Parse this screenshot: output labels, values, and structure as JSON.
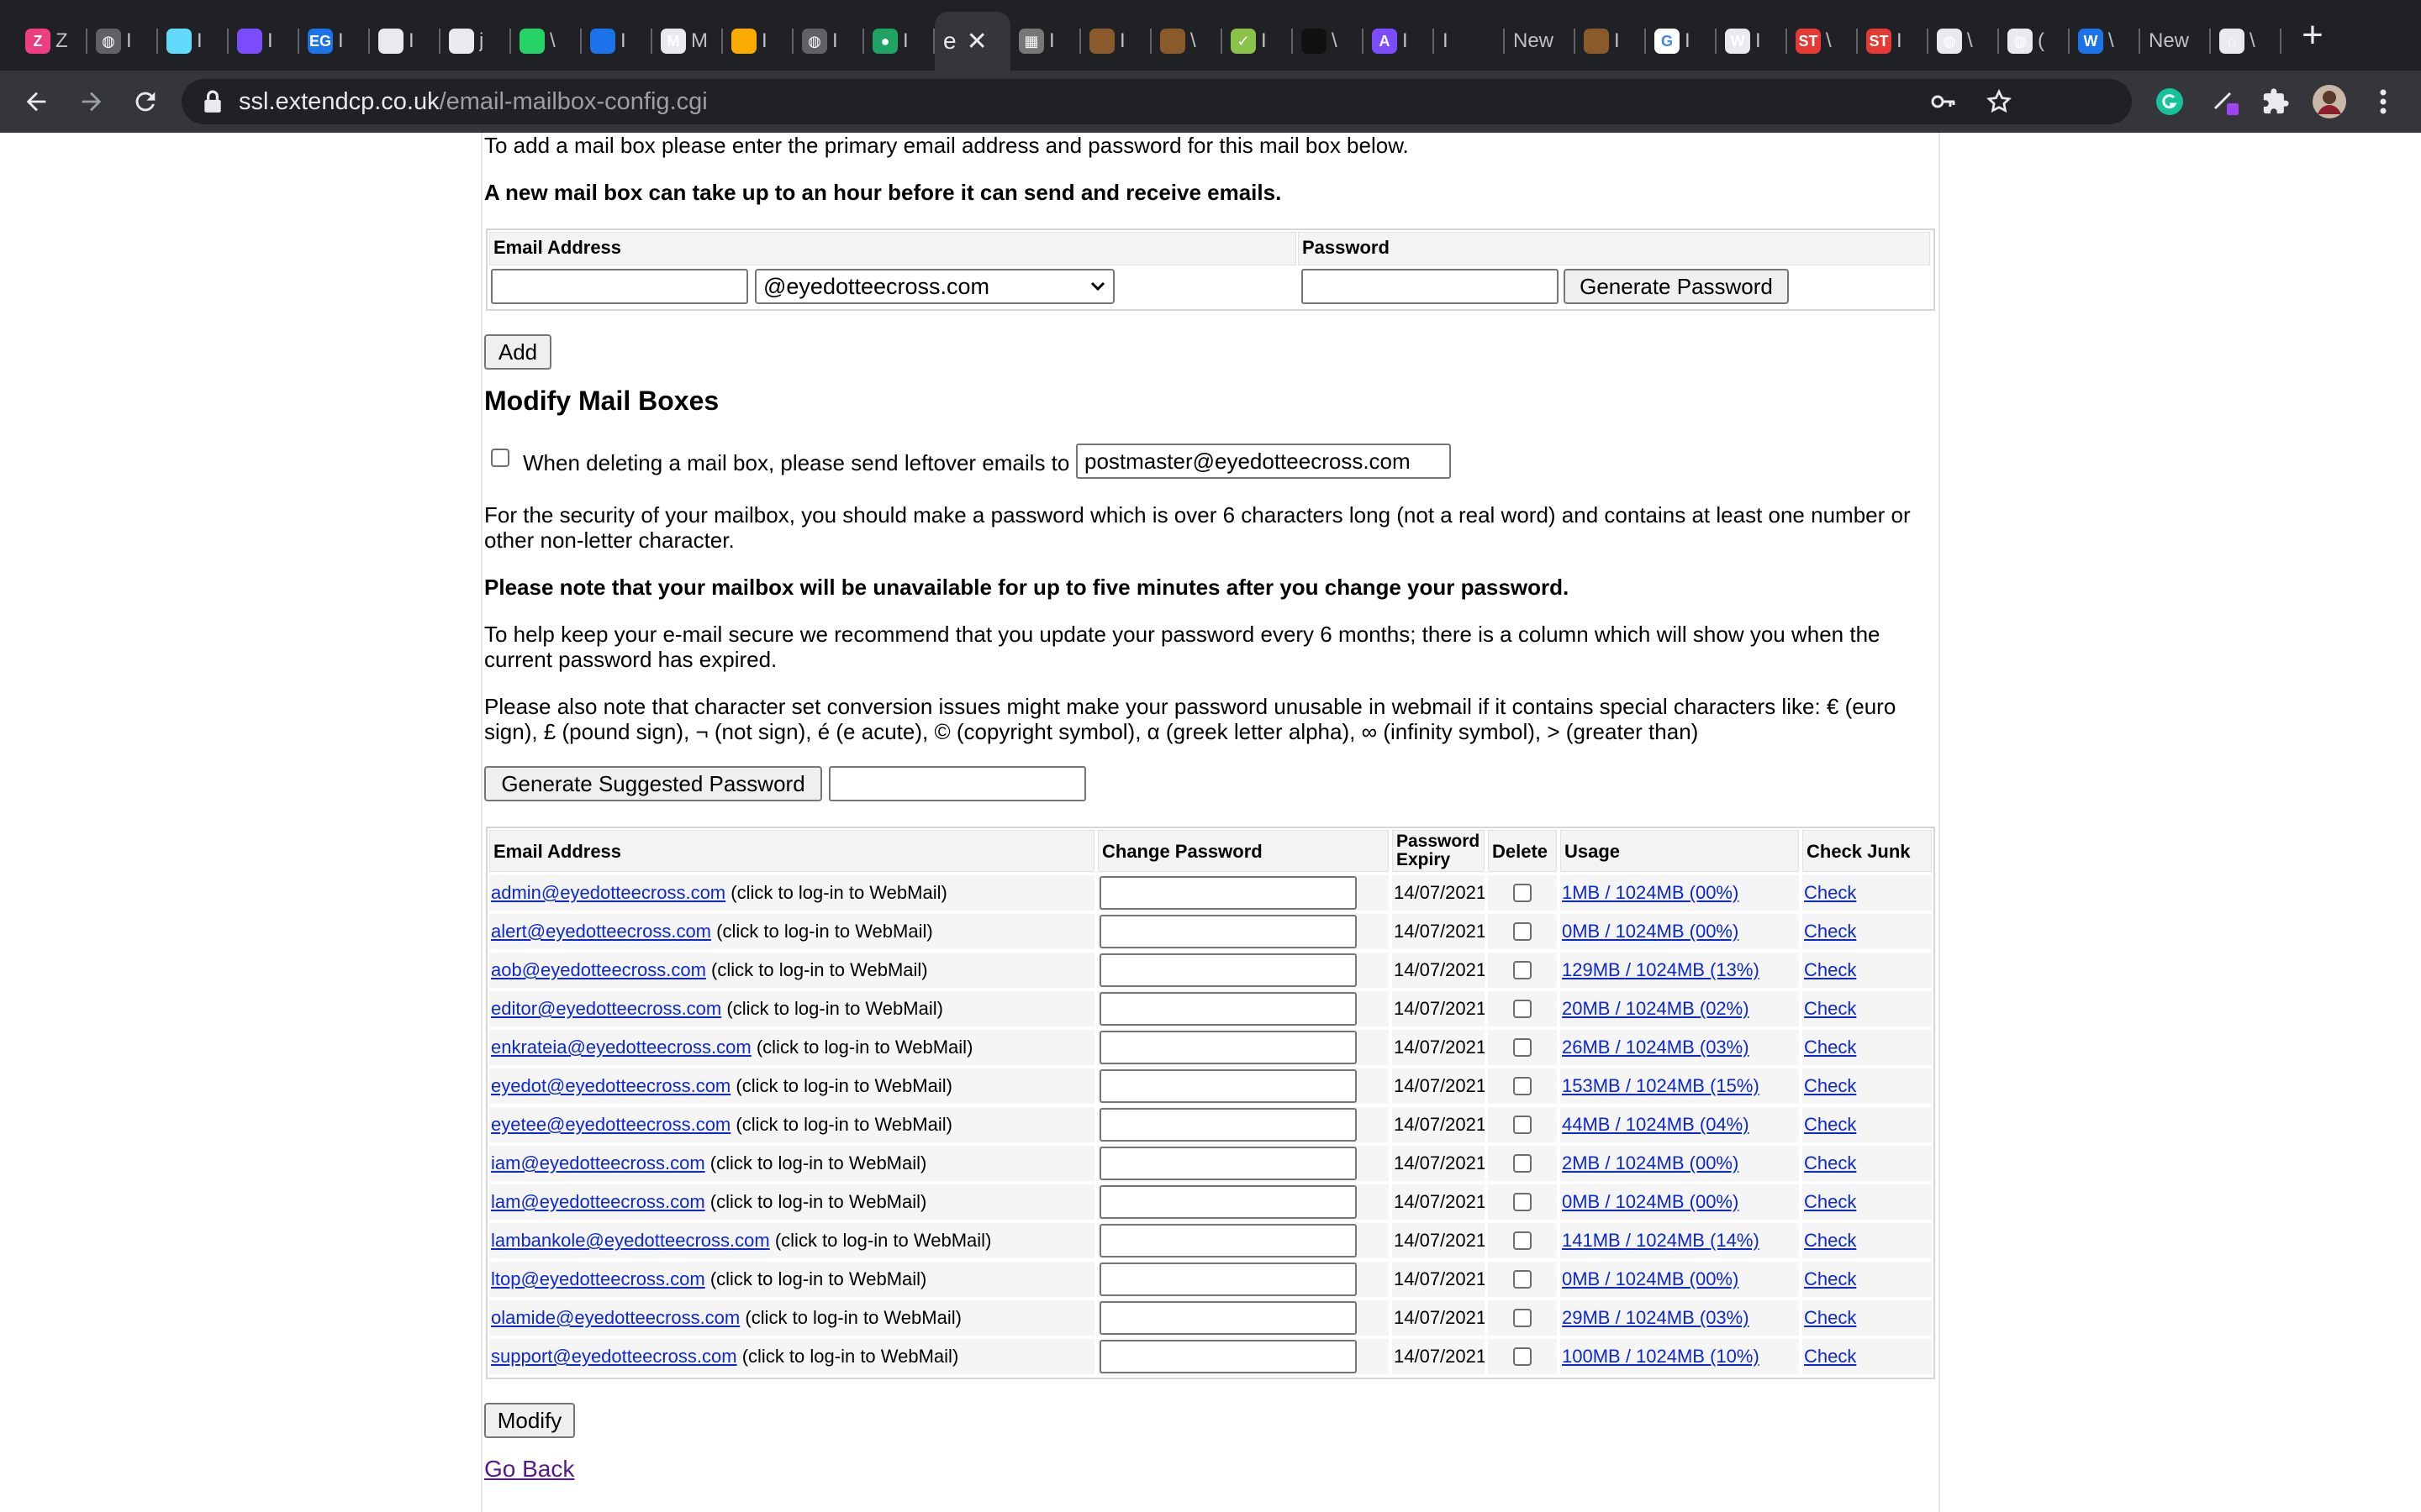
{
  "browser": {
    "tabs": [
      {
        "icon": "zeplin-icon",
        "title": "Z",
        "color": "#ee3e82"
      },
      {
        "icon": "globe-gray-icon",
        "title": "I",
        "color": "#5f6368"
      },
      {
        "icon": "react-icon",
        "title": "I",
        "color": "#61dafb"
      },
      {
        "icon": "circle-purple-icon",
        "title": "I",
        "color": "#7c4dff"
      },
      {
        "icon": "eg-icon",
        "title": "I",
        "color": "#1a73e8"
      },
      {
        "icon": "github-icon",
        "title": "I",
        "color": "#e8eaed"
      },
      {
        "icon": "github-icon",
        "title": "j",
        "color": "#e8eaed"
      },
      {
        "icon": "whatsapp-icon",
        "title": "\\",
        "color": "#25d366"
      },
      {
        "icon": "box-blue-icon",
        "title": "I",
        "color": "#1a73e8"
      },
      {
        "icon": "medium-icon",
        "title": "M",
        "color": "#e8eaed"
      },
      {
        "icon": "bars-chart-icon",
        "title": "I",
        "color": "#f9ab00"
      },
      {
        "icon": "globe-gray-icon",
        "title": "I",
        "color": "#5f6368"
      },
      {
        "icon": "green-circle-icon",
        "title": "I",
        "color": "#1ea362"
      },
      {
        "icon": "active-tab-icon",
        "title": "e",
        "color": "#35363a"
      },
      {
        "icon": "photo-icon",
        "title": "I",
        "color": "#777"
      },
      {
        "icon": "brown-doc-icon",
        "title": "I",
        "color": "#8a5a2b"
      },
      {
        "icon": "brown-doc-icon",
        "title": "\\",
        "color": "#8a5a2b"
      },
      {
        "icon": "check-green-icon",
        "title": "I",
        "color": "#8bc34a"
      },
      {
        "icon": "black-square-icon",
        "title": "\\",
        "color": "#111"
      },
      {
        "icon": "purple-a-icon",
        "title": "I",
        "color": "#7c4dff"
      },
      {
        "icon": "blank-icon",
        "title": "I",
        "color": "#202124"
      },
      {
        "icon": "new-tab-text",
        "title": "New",
        "color": "#202124"
      },
      {
        "icon": "brown-doc-icon",
        "title": "I",
        "color": "#8a5a2b"
      },
      {
        "icon": "google-icon",
        "title": "I",
        "color": "#fff"
      },
      {
        "icon": "wordpress-icon",
        "title": "I",
        "color": "#e8eaed"
      },
      {
        "icon": "red-st-icon",
        "title": "\\",
        "color": "#e53935"
      },
      {
        "icon": "red-st-icon",
        "title": "I",
        "color": "#e53935"
      },
      {
        "icon": "globe-white-icon",
        "title": "\\",
        "color": "#e8eaed"
      },
      {
        "icon": "globe-white-icon",
        "title": "(",
        "color": "#e8eaed"
      },
      {
        "icon": "w-blue-icon",
        "title": "\\",
        "color": "#1a73e8"
      },
      {
        "icon": "new-tab-text",
        "title": "New",
        "color": "#202124"
      },
      {
        "icon": "bank-icon",
        "title": "\\",
        "color": "#e8eaed"
      }
    ],
    "url_host": "ssl.extendcp.co.uk",
    "url_path": "/email-mailbox-config.cgi"
  },
  "add_section": {
    "intro": "To add a mail box please enter the primary email address and password for this mail box below.",
    "notice": "A new mail box can take up to an hour before it can send and receive emails.",
    "email_header": "Email Address",
    "password_header": "Password",
    "domain_selected": "@eyedotteecross.com",
    "generate_password_label": "Generate Password",
    "add_label": "Add"
  },
  "modify_section": {
    "title": "Modify Mail Boxes",
    "leftover_label": "When deleting a mail box, please send leftover emails to",
    "leftover_value": "postmaster@eyedotteecross.com",
    "security_text": "For the security of your mailbox, you should make a password which is over 6 characters long (not a real word) and contains at least one number or other non-letter character.",
    "unavailable_text": "Please note that your mailbox will be unavailable for up to five minutes after you change your password.",
    "expiry_text": "To help keep your e-mail secure we recommend that you update your password every 6 months; there is a column which will show you when the current password has expired.",
    "charset_text": "Please also note that character set conversion issues might make your password unusable in webmail if it contains special characters like: € (euro sign), £ (pound sign), ¬ (not sign), é (e acute), © (copyright symbol), α (greek letter alpha), ∞ (infinity symbol), > (greater than)",
    "suggest_label": "Generate Suggested Password"
  },
  "mailbox_table": {
    "headers": {
      "email": "Email Address",
      "change_password": "Change Password",
      "expiry": "Password Expiry",
      "delete": "Delete",
      "usage": "Usage",
      "check_junk": "Check Junk"
    },
    "webmail_note": "(click to log-in to WebMail)",
    "check_label": "Check",
    "rows": [
      {
        "email": "admin@eyedotteecross.com",
        "expiry": "14/07/2021",
        "usage": "1MB / 1024MB (00%)"
      },
      {
        "email": "alert@eyedotteecross.com",
        "expiry": "14/07/2021",
        "usage": "0MB / 1024MB (00%)"
      },
      {
        "email": "aob@eyedotteecross.com",
        "expiry": "14/07/2021",
        "usage": "129MB / 1024MB (13%)"
      },
      {
        "email": "editor@eyedotteecross.com",
        "expiry": "14/07/2021",
        "usage": "20MB / 1024MB (02%)"
      },
      {
        "email": "enkrateia@eyedotteecross.com",
        "expiry": "14/07/2021",
        "usage": "26MB / 1024MB (03%)"
      },
      {
        "email": "eyedot@eyedotteecross.com",
        "expiry": "14/07/2021",
        "usage": "153MB / 1024MB (15%)"
      },
      {
        "email": "eyetee@eyedotteecross.com",
        "expiry": "14/07/2021",
        "usage": "44MB / 1024MB (04%)"
      },
      {
        "email": "iam@eyedotteecross.com",
        "expiry": "14/07/2021",
        "usage": "2MB / 1024MB (00%)"
      },
      {
        "email": "lam@eyedotteecross.com",
        "expiry": "14/07/2021",
        "usage": "0MB / 1024MB (00%)"
      },
      {
        "email": "lambankole@eyedotteecross.com",
        "expiry": "14/07/2021",
        "usage": "141MB / 1024MB (14%)"
      },
      {
        "email": "ltop@eyedotteecross.com",
        "expiry": "14/07/2021",
        "usage": "0MB / 1024MB (00%)"
      },
      {
        "email": "olamide@eyedotteecross.com",
        "expiry": "14/07/2021",
        "usage": "29MB / 1024MB (03%)"
      },
      {
        "email": "support@eyedotteecross.com",
        "expiry": "14/07/2021",
        "usage": "100MB / 1024MB (10%)"
      }
    ]
  },
  "footer": {
    "modify_label": "Modify",
    "go_back_label": "Go Back"
  },
  "colors": {
    "link": "#0b27d6",
    "visited_link": "#551a8b",
    "chrome_dark": "#202124",
    "chrome_toolbar": "#35363a"
  }
}
